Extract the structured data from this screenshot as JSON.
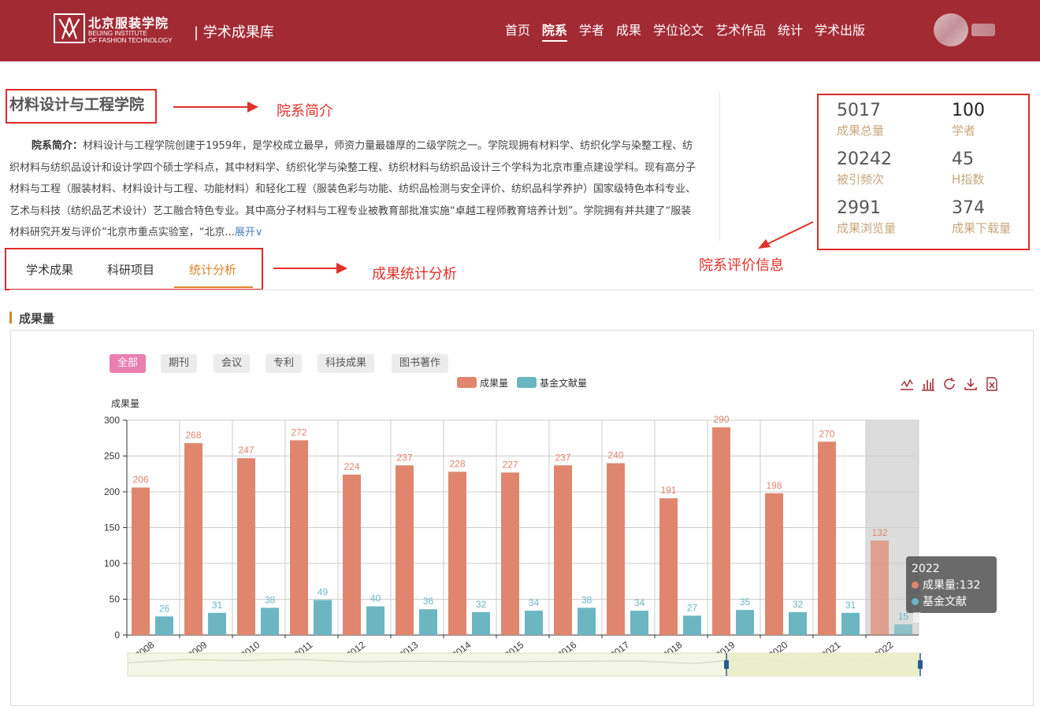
{
  "header": {
    "logo_cn": "北京服装学院",
    "logo_en": [
      "BEIJING INSTITUTE",
      "OF FASHION TECHNOLOGY"
    ],
    "site_title": "| 学术成果库",
    "nav": [
      "首页",
      "院系",
      "学者",
      "成果",
      "学位论文",
      "艺术作品",
      "统计",
      "学术出版"
    ],
    "nav_active": 1
  },
  "dept": {
    "title": "材料设计与工程学院",
    "intro_label": "院系简介：",
    "intro_text": "材料设计与工程学院创建于1959年，是学校成立最早，师资力量最雄厚的二级学院之一。学院现拥有材料学、纺织化学与染整工程、纺织材料与纺织品设计和设计学四个硕士学科点，其中材料学、纺织化学与染整工程、纺织材料与纺织品设计三个学科为北京市重点建设学科。现有高分子材料与工程（服装材料、材料设计与工程、功能材料）和轻化工程（服装色彩与功能、纺织品检测与安全评价、纺织品科学养护）国家级特色本科专业、艺术与科技（纺织品艺术设计）艺工融合特色专业。其中高分子材料与工程专业被教育部批准实施“卓越工程师教育培养计划”。学院拥有并共建了“服装材料研究开发与评价”北京市重点实验室，“北京...",
    "expand": "展开∨"
  },
  "annotations": {
    "intro": "院系简介",
    "eval": "院系评价信息",
    "stats": "成果统计分析"
  },
  "stats": [
    {
      "value": "5017",
      "label": "成果总量"
    },
    {
      "value": "100",
      "label": "学者"
    },
    {
      "value": "20242",
      "label": "被引频次"
    },
    {
      "value": "45",
      "label": "H指数"
    },
    {
      "value": "2991",
      "label": "成果浏览量"
    },
    {
      "value": "374",
      "label": "成果下载量"
    }
  ],
  "tabs": [
    "学术成果",
    "科研项目",
    "统计分析"
  ],
  "tab_active": 2,
  "section_title": "成果量",
  "filters": [
    "全部",
    "期刊",
    "会议",
    "专利",
    "科技成果",
    "图书著作"
  ],
  "filter_active": 0,
  "toolbox_icons": [
    "line-chart-icon",
    "bar-chart-icon",
    "restore-icon",
    "download-icon",
    "data-view-icon"
  ],
  "colors": {
    "brand": "#a22a33",
    "series1": "#e0866f",
    "series2": "#6cb6c2",
    "accent": "#d9842a",
    "annotation": "#e0312b"
  },
  "chart_data": {
    "type": "bar",
    "ylabel": "成果量",
    "ylim": [
      0,
      300
    ],
    "yticks": [
      0,
      50,
      100,
      150,
      200,
      250,
      300
    ],
    "grid": true,
    "legend_position": "top-center",
    "categories": [
      "2008",
      "2009",
      "2010",
      "2011",
      "2012",
      "2013",
      "2014",
      "2015",
      "2016",
      "2017",
      "2018",
      "2019",
      "2020",
      "2021",
      "2022"
    ],
    "series": [
      {
        "name": "成果量",
        "values": [
          206,
          268,
          247,
          272,
          224,
          237,
          228,
          227,
          237,
          240,
          191,
          290,
          198,
          270,
          132
        ]
      },
      {
        "name": "基金文献量",
        "values": [
          26,
          31,
          38,
          49,
          40,
          36,
          32,
          34,
          38,
          34,
          27,
          35,
          32,
          31,
          15
        ]
      }
    ],
    "highlighted_category": "2022",
    "tooltip": {
      "title": "2022",
      "lines": [
        "成果量:132",
        "基金文献量:15"
      ]
    }
  }
}
